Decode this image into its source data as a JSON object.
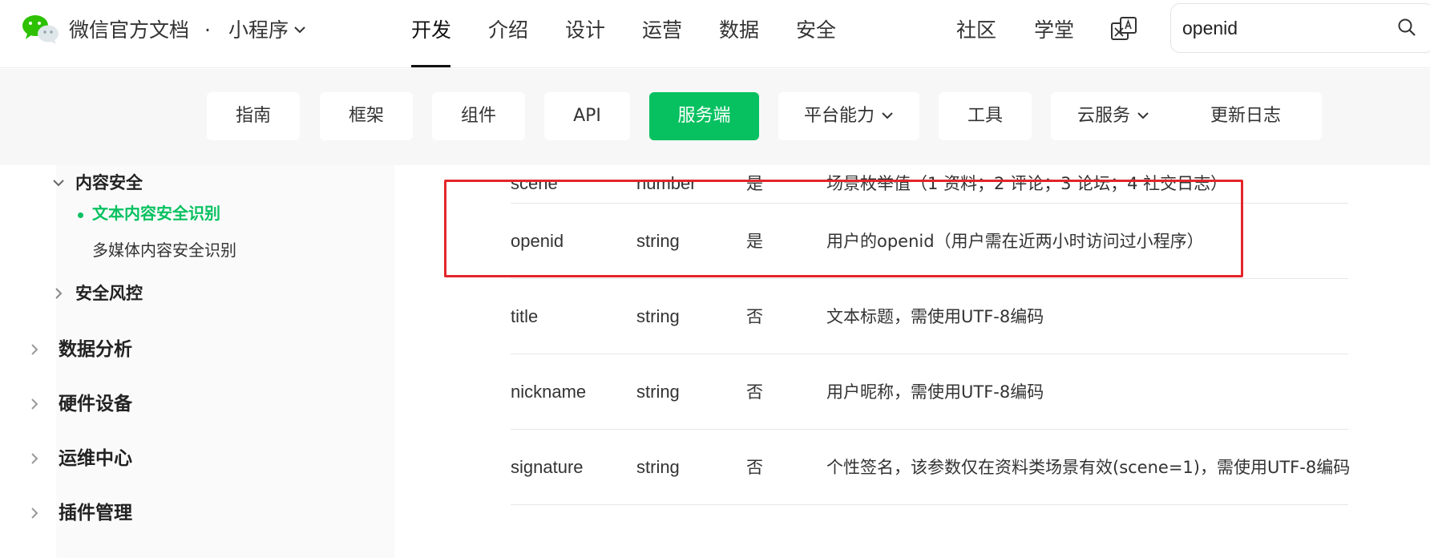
{
  "header": {
    "brand": "微信官方文档",
    "separator": "·",
    "product": "小程序",
    "nav": [
      "开发",
      "介绍",
      "设计",
      "运营",
      "数据",
      "安全"
    ],
    "right_nav": [
      "社区",
      "学堂"
    ],
    "search": {
      "value": "openid"
    },
    "icons": [
      "wechat-logo-icon",
      "chevron-down-icon",
      "translate-icon",
      "search-icon"
    ]
  },
  "subnav": {
    "tabs": [
      "指南",
      "框架",
      "组件",
      "API",
      "服务端",
      "平台能力",
      "工具",
      "云服务",
      "更新日志"
    ],
    "active": "服务端"
  },
  "sidebar": {
    "content_security": "内容安全",
    "text_security": "文本内容安全识别",
    "media_security": "多媒体内容安全识别",
    "risk_control": "安全风控",
    "data_analysis": "数据分析",
    "hardware": "硬件设备",
    "ops_center": "运维中心",
    "plugin_mgmt": "插件管理"
  },
  "table": {
    "partial_row": {
      "name": "scene",
      "type": "number",
      "required": "是",
      "desc": "场景枚举值（1 资料；2 评论；3 论坛；4 社交日志）"
    },
    "rows": [
      {
        "name": "openid",
        "type": "string",
        "required": "是",
        "desc": "用户的openid（用户需在近两小时访问过小程序）"
      },
      {
        "name": "title",
        "type": "string",
        "required": "否",
        "desc": "文本标题，需使用UTF-8编码"
      },
      {
        "name": "nickname",
        "type": "string",
        "required": "否",
        "desc": "用户昵称，需使用UTF-8编码"
      },
      {
        "name": "signature",
        "type": "string",
        "required": "否",
        "desc": "个性签名，该参数仅在资料类场景有效(scene=1)，需使用UTF-8编码"
      }
    ]
  },
  "colors": {
    "accent": "#07c160",
    "highlight": "#e3262b"
  }
}
